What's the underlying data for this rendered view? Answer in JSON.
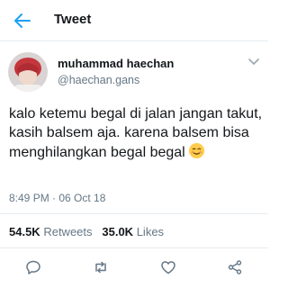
{
  "header": {
    "title": "Tweet",
    "back_icon": "arrow-left-icon"
  },
  "user": {
    "display_name": "muhammad haechan",
    "handle": "@haechan.gans"
  },
  "tweet": {
    "text": "kalo ketemu begal di jalan jangan takut, kasih balsem aja. karena balsem bisa menghilangkan begal begal",
    "emoji": "smiling-face-icon",
    "timestamp": "8:49 PM · 06 Oct 18"
  },
  "stats": {
    "retweets_count": "54.5K",
    "retweets_label": "Retweets",
    "likes_count": "35.0K",
    "likes_label": "Likes"
  },
  "actions": [
    "reply-icon",
    "retweet-icon",
    "like-icon",
    "share-icon"
  ],
  "colors": {
    "accent": "#1da1f2",
    "muted": "#657786",
    "text": "#14171a"
  }
}
